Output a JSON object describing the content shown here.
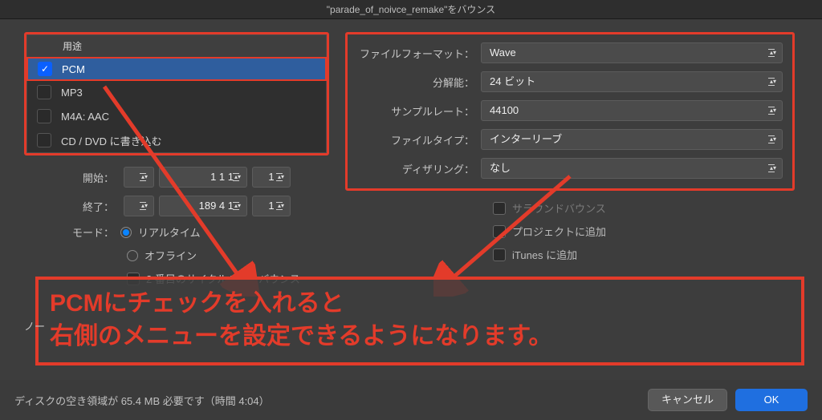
{
  "title": "\"parade_of_noivce_remake\"をバウンス",
  "formats": {
    "header": "用途",
    "items": [
      {
        "label": "PCM",
        "checked": true,
        "selected": true
      },
      {
        "label": "MP3",
        "checked": false,
        "selected": false
      },
      {
        "label": "M4A: AAC",
        "checked": false,
        "selected": false
      },
      {
        "label": "CD / DVD に書き込む",
        "checked": false,
        "selected": false
      }
    ]
  },
  "range": {
    "start_label": "開始：",
    "end_label": "終了：",
    "start_main": "1 1 1",
    "start_sub": "1",
    "end_main": "189 4 1",
    "end_sub": "1"
  },
  "mode": {
    "label": "モード：",
    "realtime": "リアルタイム",
    "offline": "オフライン",
    "bounce2": "2 番目のサイクルパスをバウンス"
  },
  "settings": {
    "file_format_label": "ファイルフォーマット：",
    "file_format_value": "Wave",
    "bit_label": "分解能：",
    "bit_value": "24 ビット",
    "sr_label": "サンプルレート：",
    "sr_value": "44100",
    "ftype_label": "ファイルタイプ：",
    "ftype_value": "インターリーブ",
    "dither_label": "ディザリング：",
    "dither_value": "なし"
  },
  "right_checks": {
    "surround": "サラウンドバウンス",
    "project": "プロジェクトに追加",
    "itunes": "iTunes に追加"
  },
  "caption": {
    "line1": "PCMにチェックを入れると",
    "line2": "右側のメニューを設定できるようになります。"
  },
  "footer": {
    "status": "ディスクの空き領域が 65.4 MB 必要です（時間 4:04）",
    "cancel": "キャンセル",
    "ok": "OK"
  },
  "norm_label": "ノー"
}
